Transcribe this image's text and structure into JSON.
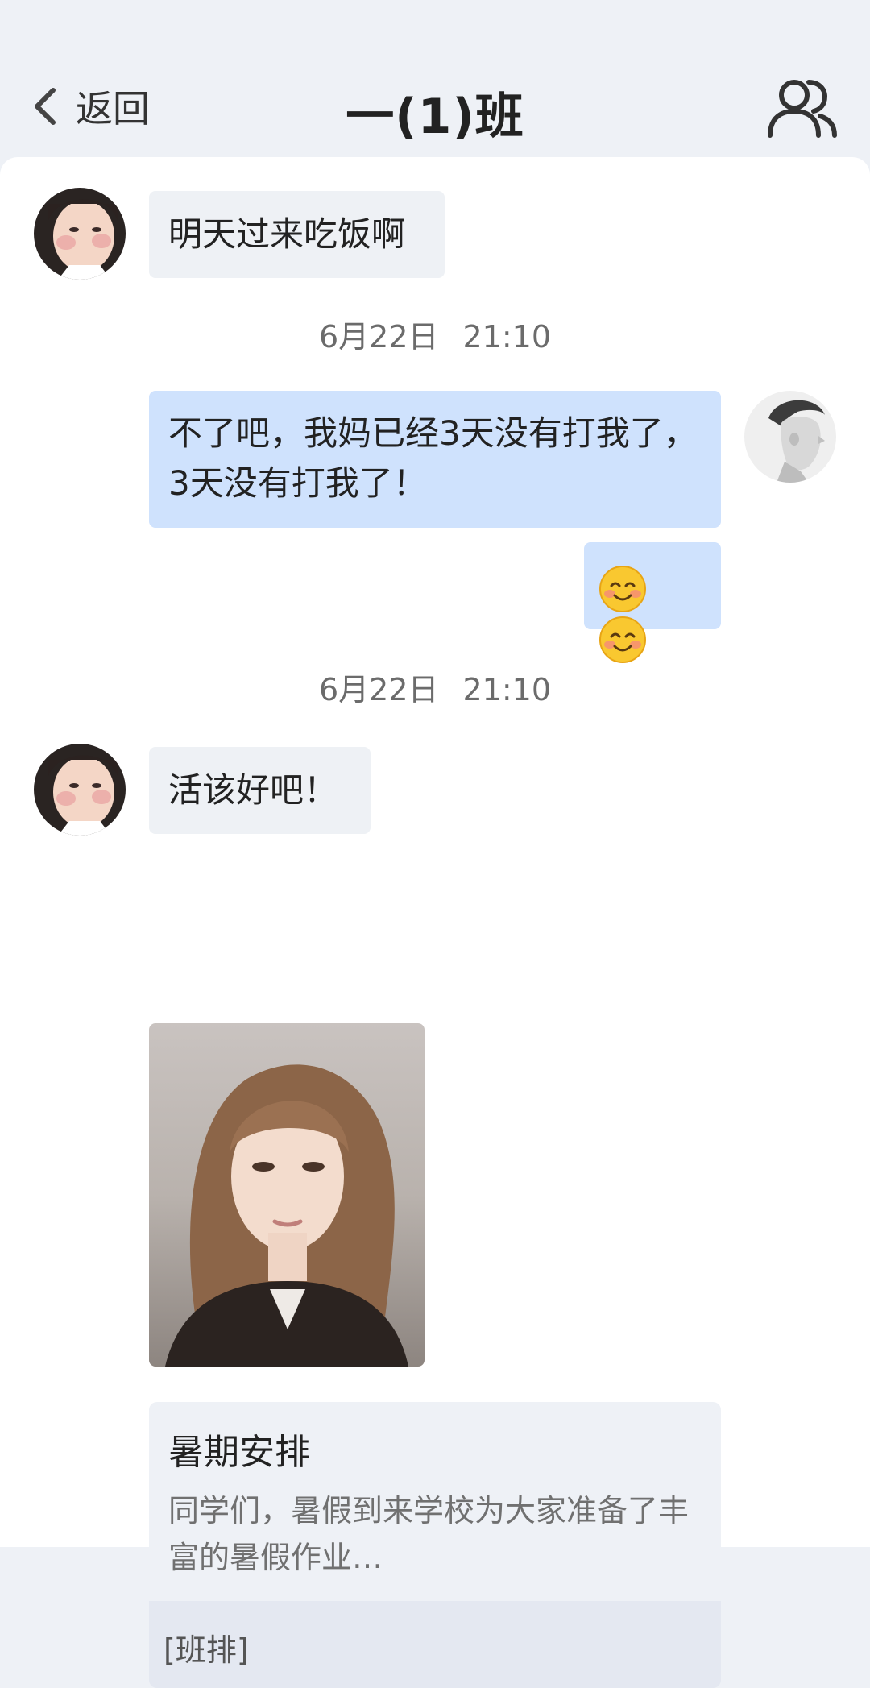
{
  "header": {
    "back_label": "返回",
    "title": "一(1)班"
  },
  "messages": [
    {
      "text": "明天过来吃饭啊"
    },
    {
      "time_date": "6月22日",
      "time_clock": "21:10"
    },
    {
      "text": "不了吧，我妈已经3天没有打我了，3天没有打我了！"
    },
    {
      "emojis": [
        "smiling-face-icon",
        "smiling-face-icon"
      ]
    },
    {
      "time_date": "6月22日",
      "time_clock": "21:10"
    },
    {
      "text": "活该好吧！"
    }
  ],
  "card": {
    "title": "暑期安排",
    "text": "同学们，暑假到来学校为大家准备了丰富的暑假作业…",
    "tag": "[班排]"
  },
  "colors": {
    "background": "#eef1f6",
    "incoming_bubble": "#eef1f5",
    "outgoing_bubble": "#cfe2fd"
  }
}
